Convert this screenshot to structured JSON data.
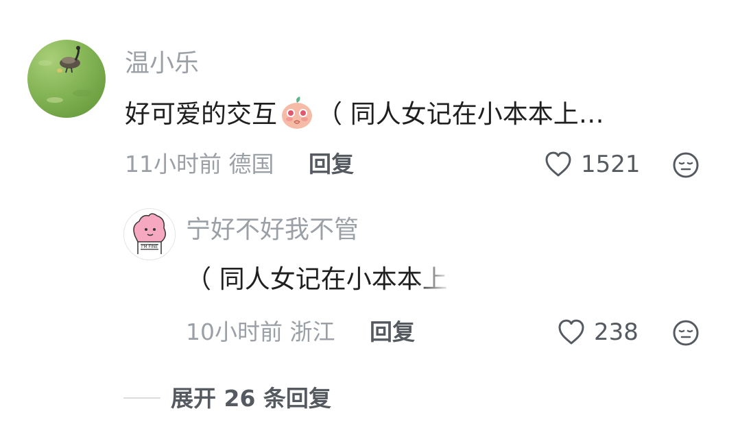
{
  "comment": {
    "username": "温小乐",
    "text_before": "好可爱的交互",
    "emoji": "peach-shy-emoji",
    "text_after": "（ 同人女记在小本本上…",
    "time": "11小时前",
    "location": "德国",
    "reply_label": "回复",
    "like_count": "1521"
  },
  "reply": {
    "username": "宁好不好我不管",
    "text": "（ 同人女记在小本本上",
    "avatar_caption": "I'M FINE",
    "time": "10小时前",
    "location": "浙江",
    "reply_label": "回复",
    "like_count": "238"
  },
  "expand": {
    "label": "展开 26 条回复"
  },
  "colors": {
    "meta_gray": "#9aa0a6",
    "text_dark": "#1f1f1f",
    "action_gray": "#555a60",
    "avatar_pink": "#f6a8c0"
  }
}
